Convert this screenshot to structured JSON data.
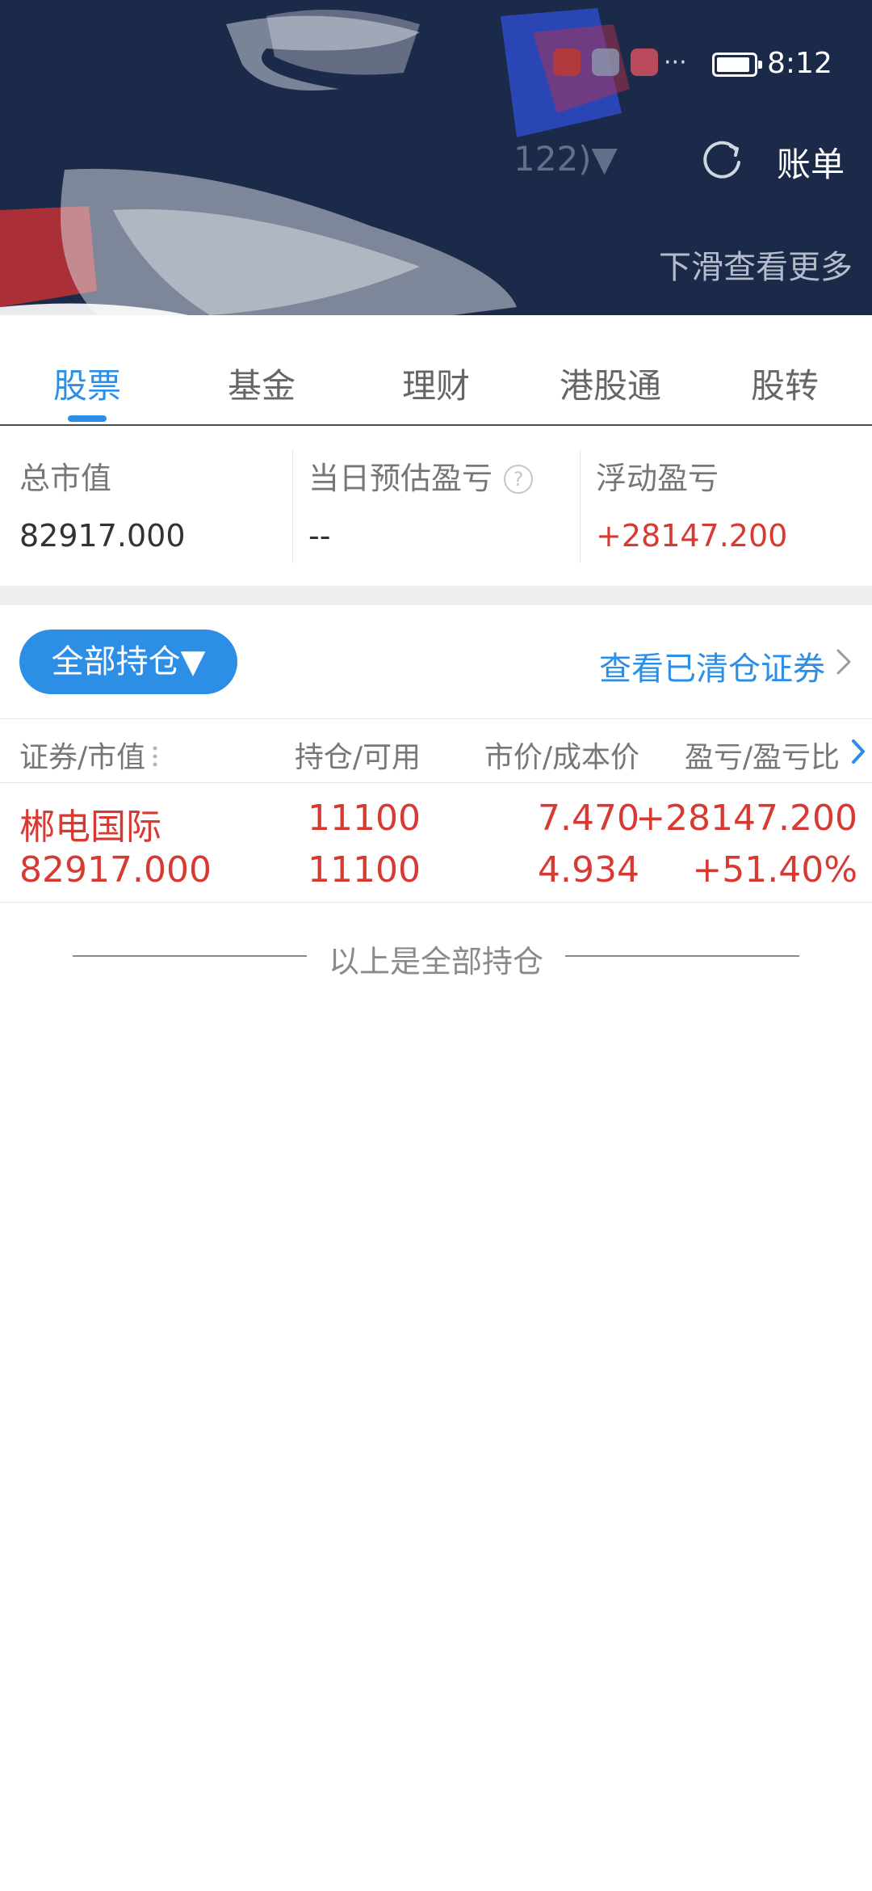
{
  "status_bar": {
    "time": "8:12",
    "more": "···"
  },
  "header": {
    "account_fragment": "122)▼",
    "bill_label": "账单",
    "slide_hint": "下滑查看更多",
    "icons": [
      "refresh-icon",
      "battery-icon"
    ]
  },
  "tabs": [
    {
      "label": "股票",
      "active": true
    },
    {
      "label": "基金",
      "active": false
    },
    {
      "label": "理财",
      "active": false
    },
    {
      "label": "港股通",
      "active": false
    },
    {
      "label": "股转",
      "active": false
    }
  ],
  "summary": {
    "total_value_label": "总市值",
    "total_value": "82917.000",
    "daily_pl_label": "当日预估盈亏",
    "daily_pl_value": "--",
    "help_symbol": "?",
    "floating_pl_label": "浮动盈亏",
    "floating_pl_value": "+28147.200"
  },
  "filter": {
    "all_positions_label": "全部持仓▼",
    "cleared_link": "查看已清仓证券"
  },
  "table": {
    "headers": [
      "证券/市值",
      "持仓/可用",
      "市价/成本价",
      "盈亏/盈亏比"
    ],
    "rows": [
      {
        "name": "郴电国际",
        "market_value": "82917.000",
        "position": "11100",
        "available": "11100",
        "price": "7.470",
        "cost": "4.934",
        "pl": "+28147.200",
        "pl_ratio": "+51.40%"
      }
    ],
    "end_note": "以上是全部持仓"
  },
  "colors": {
    "header_bg": "#1c2a49",
    "accent_blue": "#2d8ee6",
    "profit_red": "#d63a33"
  }
}
